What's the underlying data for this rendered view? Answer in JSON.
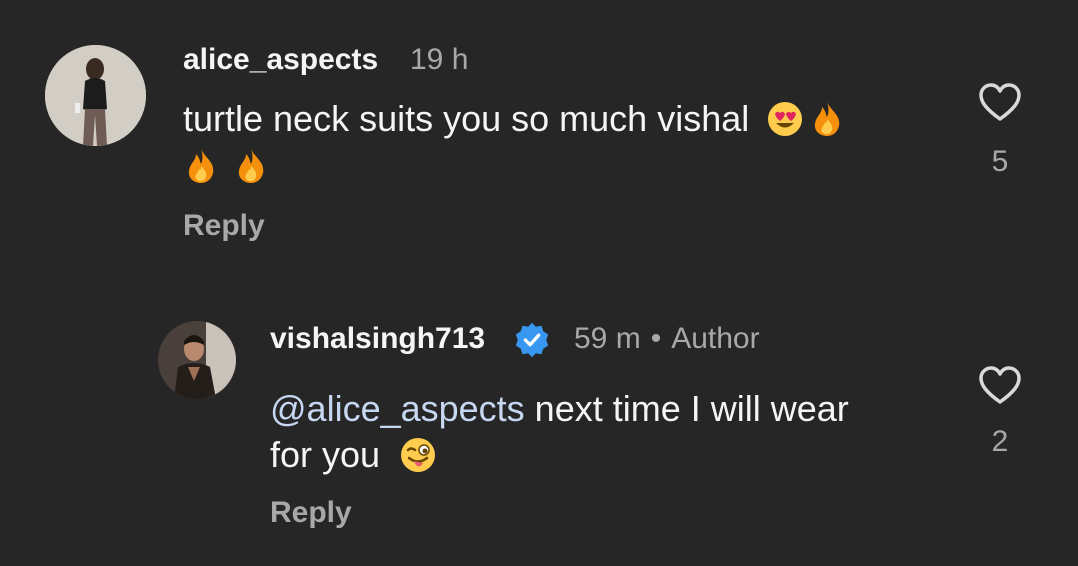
{
  "comments": [
    {
      "username": "alice_aspects",
      "time": "19 h",
      "text": "turtle neck suits you so much vishal",
      "likes": "5",
      "reply_label": "Reply"
    },
    {
      "username": "vishalsingh713",
      "verified": true,
      "time": "59 m",
      "separator": "•",
      "role": "Author",
      "mention": "@alice_aspects",
      "text_line1": " next time I will wear",
      "text_line2": "for you",
      "likes": "2",
      "reply_label": "Reply"
    }
  ],
  "colors": {
    "background": "#262626",
    "primary_text": "#f5f5f5",
    "secondary_text": "#a8a8a8",
    "mention": "#c7d7f2",
    "verified_badge": "#3897f0"
  },
  "icons": [
    "heart-outline-icon",
    "verified-badge-icon",
    "heart-eyes-emoji",
    "fire-emoji",
    "winking-tongue-emoji"
  ]
}
